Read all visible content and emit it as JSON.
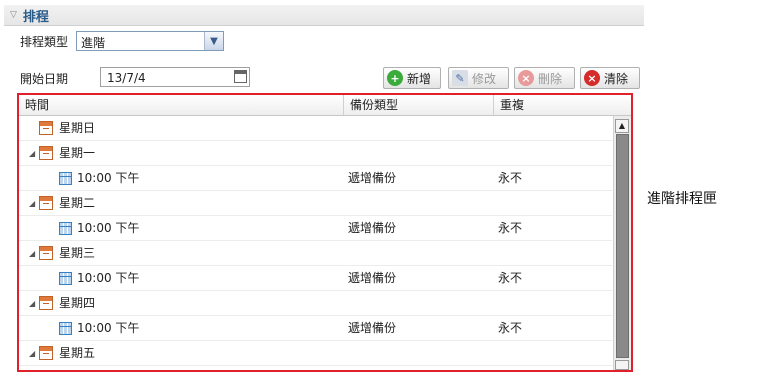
{
  "section": {
    "title": "排程"
  },
  "form": {
    "type_label": "排程類型",
    "type_value": "進階",
    "start_date_label": "開始日期",
    "start_date_value": "13/7/4"
  },
  "toolbar": {
    "add_label": "新增",
    "edit_label": "修改",
    "delete_label": "刪除",
    "clear_label": "清除"
  },
  "grid": {
    "columns": [
      "時間",
      "備份類型",
      "重複"
    ],
    "rows": [
      {
        "kind": "day",
        "label": "星期日",
        "expanded": false,
        "type": "",
        "repeat": ""
      },
      {
        "kind": "day",
        "label": "星期一",
        "expanded": true,
        "type": "",
        "repeat": ""
      },
      {
        "kind": "time",
        "label": "10:00 下午",
        "type": "遞增備份",
        "repeat": "永不"
      },
      {
        "kind": "day",
        "label": "星期二",
        "expanded": true,
        "type": "",
        "repeat": ""
      },
      {
        "kind": "time",
        "label": "10:00 下午",
        "type": "遞增備份",
        "repeat": "永不"
      },
      {
        "kind": "day",
        "label": "星期三",
        "expanded": true,
        "type": "",
        "repeat": ""
      },
      {
        "kind": "time",
        "label": "10:00 下午",
        "type": "遞增備份",
        "repeat": "永不"
      },
      {
        "kind": "day",
        "label": "星期四",
        "expanded": true,
        "type": "",
        "repeat": ""
      },
      {
        "kind": "time",
        "label": "10:00 下午",
        "type": "遞增備份",
        "repeat": "永不"
      },
      {
        "kind": "day",
        "label": "星期五",
        "expanded": true,
        "type": "",
        "repeat": ""
      }
    ]
  },
  "callout": {
    "text": "進階排程匣"
  },
  "colors": {
    "highlight_border": "#e0202a",
    "section_title": "#2a5c8a"
  }
}
